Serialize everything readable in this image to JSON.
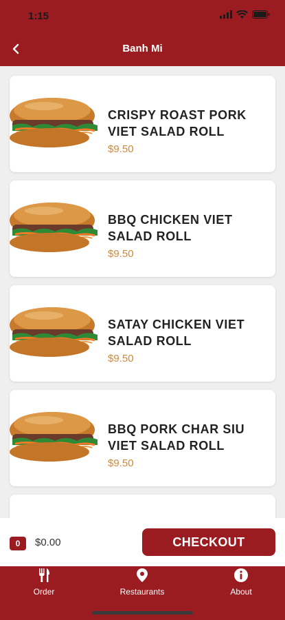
{
  "status_bar": {
    "time": "1:15"
  },
  "nav": {
    "title": "Banh Mi"
  },
  "items": [
    {
      "name": "CRISPY ROAST PORK VIET SALAD ROLL",
      "price": "$9.50",
      "image": "banh-mi-roast-pork"
    },
    {
      "name": "BBQ CHICKEN VIET SALAD ROLL",
      "price": "$9.50",
      "image": "banh-mi-bbq-chicken"
    },
    {
      "name": "SATAY CHICKEN VIET SALAD ROLL",
      "price": "$9.50",
      "image": "banh-mi-satay-chicken"
    },
    {
      "name": "BBQ PORK CHAR SIU VIET SALAD ROLL",
      "price": "$9.50",
      "image": "banh-mi-char-siu"
    }
  ],
  "cart": {
    "count": "0",
    "total": "$0.00",
    "checkout_label": "CHECKOUT"
  },
  "tabs": [
    {
      "label": "Order",
      "icon": "fork-knife-icon"
    },
    {
      "label": "Restaurants",
      "icon": "location-pin-icon"
    },
    {
      "label": "About",
      "icon": "info-icon"
    }
  ],
  "colors": {
    "brand": "#9b1c20",
    "price": "#d08a3a",
    "background": "#efefef"
  }
}
